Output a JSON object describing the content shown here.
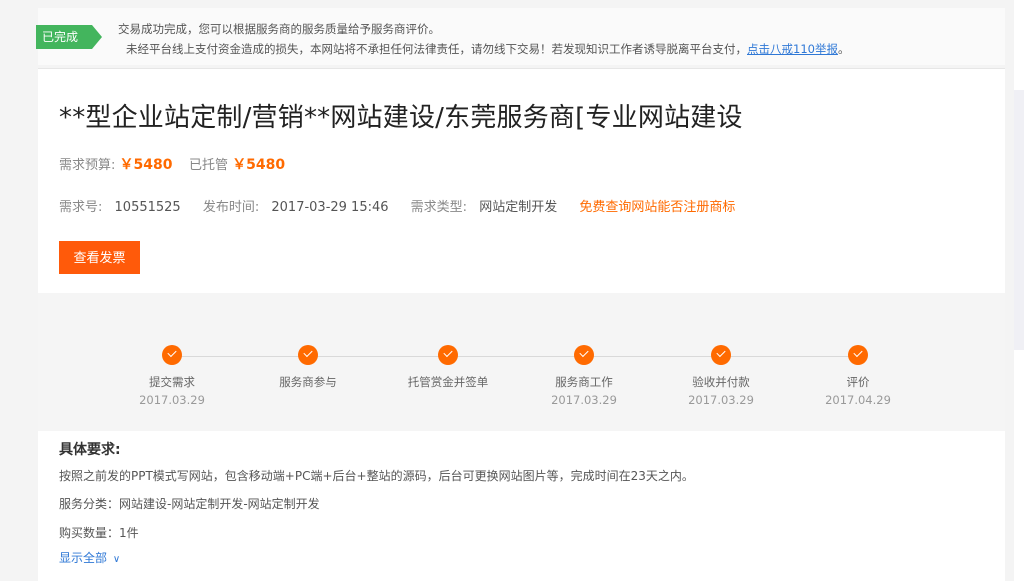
{
  "notice": {
    "badge": "已完成",
    "line1": "交易成功完成，您可以根据服务商的服务质量给予服务商评价。",
    "line2": "未经平台线上支付资金造成的损失，本网站将不承担任何法律责任，请勿线下交易！若发现知识工作者诱导脱离平台支付，",
    "report_link": "点击八戒110举报",
    "line2_end": "。"
  },
  "order": {
    "title": "**型企业站定制/营销**网站建设/东莞服务商[专业网站建设",
    "budget_label": "需求预算:",
    "budget_value": "￥5480",
    "escrow_label": "已托管",
    "escrow_value": "￥5480",
    "id_label": "需求号:",
    "id_value": "10551525",
    "publish_label": "发布时间:",
    "publish_value": "2017-03-29 15:46",
    "type_label": "需求类型:",
    "type_value": "网站定制开发",
    "trademark_link": "免费查询网站能否注册商标",
    "invoice_button": "查看发票"
  },
  "steps": [
    {
      "label": "提交需求",
      "date": "2017.03.29"
    },
    {
      "label": "服务商参与",
      "date": ""
    },
    {
      "label": "托管赏金并签单",
      "date": ""
    },
    {
      "label": "服务商工作",
      "date": "2017.03.29"
    },
    {
      "label": "验收并付款",
      "date": "2017.03.29"
    },
    {
      "label": "评价",
      "date": "2017.04.29"
    }
  ],
  "requirements": {
    "title": "具体要求:",
    "description": "按照之前发的PPT模式写网站，包含移动端+PC端+后台+整站的源码，后台可更换网站图片等，完成时间在23天之内。",
    "category": "服务分类：网站建设-网站定制开发-网站定制开发",
    "quantity": "购买数量：1件",
    "show_all": "显示全部"
  },
  "colors": {
    "accent": "#ff6a00",
    "success": "#43b55d",
    "link": "#2f78d6"
  }
}
